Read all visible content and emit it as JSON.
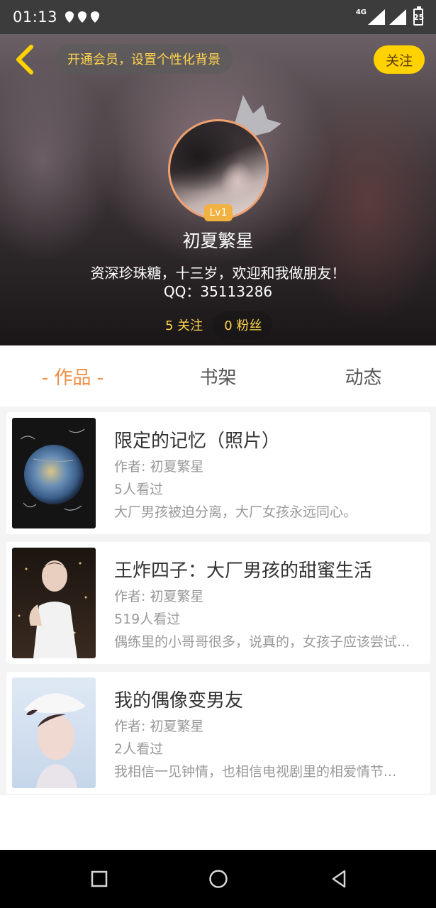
{
  "status_bar": {
    "time": "01:13",
    "network": "4G",
    "battery": "25",
    "icons": [
      "notification-drop-icon",
      "notification-drop-icon",
      "notification-drop-icon",
      "signal-icon",
      "signal-icon",
      "battery-icon"
    ]
  },
  "header": {
    "back_icon": "back-chevron-icon",
    "vip_text": "开通会员，设置个性化背景",
    "follow_label": "关注",
    "avatar_level": "Lv1",
    "nickname": "初夏繁星",
    "bio_line1": "资深珍珠糖，十三岁，欢迎和我做朋友！",
    "bio_line2": "QQ：35113286",
    "following": "5 关注",
    "fans": "0 粉丝"
  },
  "tabs": [
    {
      "label": "- 作品 -",
      "active": true
    },
    {
      "label": "书架",
      "active": false
    },
    {
      "label": "动态",
      "active": false
    }
  ],
  "works": [
    {
      "title": "限定的记忆（照片）",
      "author": "作者: 初夏繁星",
      "views": "5人看过",
      "desc": "大厂男孩被迫分离，大厂女孩永远同心。"
    },
    {
      "title": "王炸四子：大厂男孩的甜蜜生活",
      "author": "作者: 初夏繁星",
      "views": "519人看过",
      "desc": "偶练里的小哥哥很多，说真的，女孩子应该尝试..."
    },
    {
      "title": "我的偶像变男友",
      "author": "作者: 初夏繁星",
      "views": "2人看过",
      "desc": "我相信一见钟情，也相信电视剧里的相爱情节..."
    }
  ],
  "nav_bar": {
    "icons": [
      "recents-square-icon",
      "home-circle-icon",
      "back-triangle-icon"
    ]
  },
  "colors": {
    "accent_orange": "#f08f45",
    "follow_yellow": "#ffd200",
    "vip_text_yellow": "#ffd34d",
    "level_badge": "#f2b241"
  }
}
